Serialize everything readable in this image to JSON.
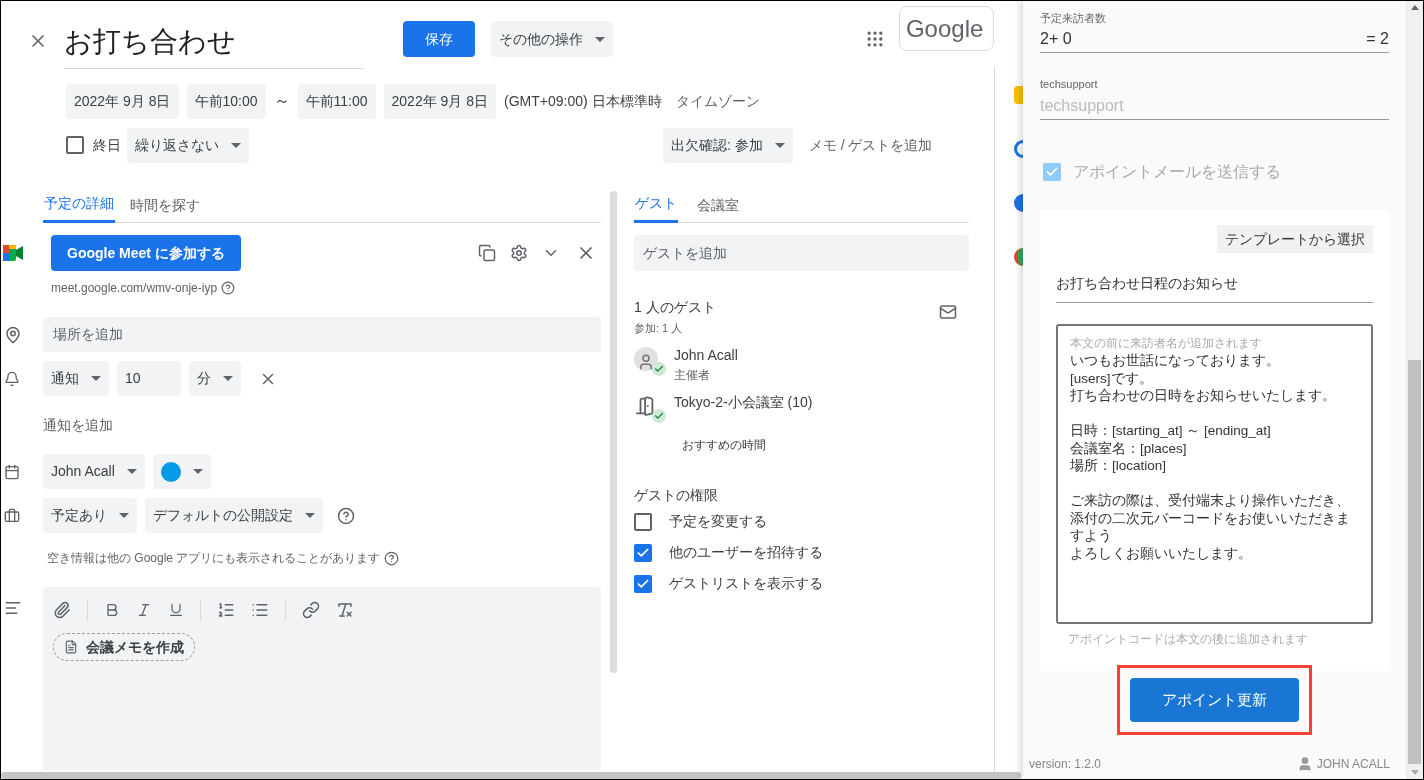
{
  "header": {
    "title": "お打ち合わせ",
    "save": "保存",
    "more_actions": "その他の操作",
    "logo": "Google"
  },
  "datetime": {
    "start_date": "2022年 9月 8日",
    "start_time": "午前10:00",
    "separator": "～",
    "end_time": "午前11:00",
    "end_date": "2022年 9月 8日",
    "timezone": "(GMT+09:00) 日本標準時",
    "timezone_link": "タイムゾーン"
  },
  "all_day": {
    "label": "終日",
    "checked": false
  },
  "repeat": "繰り返さない",
  "rsvp": "出欠確認: 参加",
  "add_note": "メモ / ゲストを追加",
  "detail_tabs": [
    {
      "label": "予定の詳細",
      "selected": true
    },
    {
      "label": "時間を探す",
      "selected": false
    }
  ],
  "meet": {
    "button": "Google Meet に参加する",
    "link": "meet.google.com/wmv-onje-iyp"
  },
  "location": {
    "placeholder": "場所を追加"
  },
  "notification": {
    "type": "通知",
    "value": "10",
    "unit": "分"
  },
  "add_notification": "通知を追加",
  "calendar": {
    "owner": "John Acall",
    "color": "#039be5"
  },
  "availability": "予定あり",
  "visibility": "デフォルトの公開設定",
  "availability_note": "空き情報は他の Google アプリにも表示されることがあります",
  "description": {
    "meeting_notes": "会議メモを作成"
  },
  "guest_tabs": [
    {
      "label": "ゲスト",
      "selected": true
    },
    {
      "label": "会議室",
      "selected": false
    }
  ],
  "guest_field": {
    "placeholder": "ゲストを追加"
  },
  "guests": {
    "count": "1 人のゲスト",
    "attending": "参加: 1 人",
    "items": [
      {
        "kind": "person",
        "name": "John Acall",
        "role": "主催者",
        "accepted": true
      },
      {
        "kind": "room",
        "name": "Tokyo-2-小会議室 (10)",
        "accepted": true
      }
    ]
  },
  "suggested_times": "おすすめの時間",
  "permissions": {
    "title": "ゲストの権限",
    "items": [
      {
        "label": "予定を変更する",
        "checked": false
      },
      {
        "label": "他のユーザーを招待する",
        "checked": true
      },
      {
        "label": "ゲストリストを表示する",
        "checked": true
      }
    ]
  },
  "panel": {
    "visitors": {
      "label": "予定来訪者数",
      "value": "2+ 0",
      "total": "= 2"
    },
    "techsupport": {
      "label": "techsupport",
      "placeholder": "techsupport"
    },
    "send_mail": {
      "label": "アポイントメールを送信する",
      "checked": true,
      "disabled": true
    },
    "template_button": "テンプレートから選択",
    "subject": "お打ち合わせ日程のお知らせ",
    "body_hint": "本文の前に来訪者名が追加されます",
    "body_paragraphs": [
      [
        "いつもお世話になっております。",
        "[users]です。",
        "打ち合わせの日時をお知らせいたします。"
      ],
      [
        "日時：[starting_at] ～ [ending_at]",
        "会議室名：[places]",
        "場所：[location]"
      ],
      [
        "ご来訪の際は、受付端末より操作いただき、",
        "添付の二次元バーコードをお使いいただきますよう",
        "よろしくお願いいたします。"
      ]
    ],
    "code_note": "アポイントコードは本文の後に追加されます",
    "submit": {
      "label": "アポイント更新",
      "highlighted": true
    },
    "version": "version: 1.2.0",
    "user": "JOHN ACALL"
  }
}
